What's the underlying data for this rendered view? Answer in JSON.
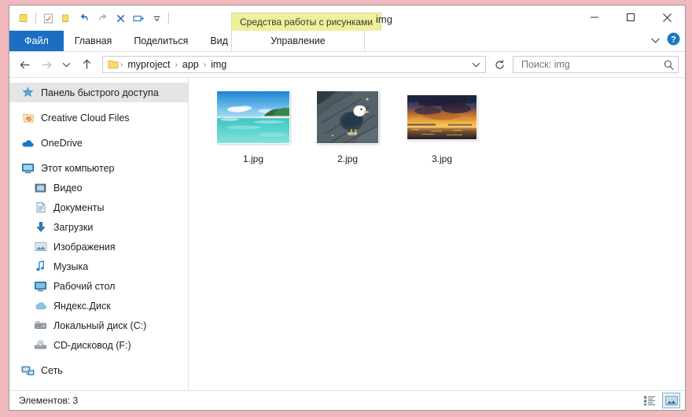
{
  "window": {
    "title": "img",
    "contextual_tab_title": "Средства работы с рисунками",
    "contextual_tab_sub": "Управление",
    "minimize_label": "Свернуть",
    "maximize_label": "Развернуть",
    "close_label": "Закрыть",
    "accent_color": "#1b6ec2",
    "contextual_tab_color": "#efef9c",
    "frame_background": "#f0b8bd"
  },
  "quick_access": {
    "items": [
      {
        "icon": "folder-icon",
        "label": "Проводник"
      },
      {
        "icon": "separator",
        "label": ""
      },
      {
        "icon": "properties-icon",
        "label": "Свойства"
      },
      {
        "icon": "new-folder-icon",
        "label": "Создать папку"
      },
      {
        "icon": "undo-icon",
        "label": "Отменить"
      },
      {
        "icon": "redo-icon",
        "label": "Вернуть"
      },
      {
        "icon": "delete-icon",
        "label": "Удалить"
      },
      {
        "icon": "rename-icon",
        "label": "Переименовать"
      },
      {
        "icon": "chevron-down-icon",
        "label": "Настройка панели быстрого доступа"
      }
    ]
  },
  "ribbon": {
    "tabs": [
      {
        "label": "Файл",
        "selected": true
      },
      {
        "label": "Главная",
        "selected": false
      },
      {
        "label": "Поделиться",
        "selected": false
      },
      {
        "label": "Вид",
        "selected": false
      }
    ],
    "expand_icon": "chevron-down-icon",
    "help_icon": "help-icon"
  },
  "address": {
    "back_label": "Назад",
    "forward_label": "Вперед",
    "recent_label": "Последние расположения",
    "up_label": "Вверх",
    "refresh_label": "Обновить",
    "breadcrumbs": [
      "myproject",
      "app",
      "img"
    ],
    "separator": "›",
    "dropdown_icon": "chevron-down-icon"
  },
  "search": {
    "value": "",
    "placeholder": "Поиск: img",
    "icon": "search-icon"
  },
  "sidebar": {
    "items": [
      {
        "label": "Панель быстрого доступа",
        "icon": "star-icon",
        "indent": 0,
        "selected": true,
        "gap_before": false
      },
      {
        "label": "Creative Cloud Files",
        "icon": "creative-cloud-icon",
        "indent": 0,
        "selected": false,
        "gap_before": true
      },
      {
        "label": "OneDrive",
        "icon": "onedrive-icon",
        "indent": 0,
        "selected": false,
        "gap_before": true
      },
      {
        "label": "Этот компьютер",
        "icon": "this-pc-icon",
        "indent": 0,
        "selected": false,
        "gap_before": true
      },
      {
        "label": "Видео",
        "icon": "videos-icon",
        "indent": 1,
        "selected": false,
        "gap_before": false
      },
      {
        "label": "Документы",
        "icon": "documents-icon",
        "indent": 1,
        "selected": false,
        "gap_before": false
      },
      {
        "label": "Загрузки",
        "icon": "downloads-icon",
        "indent": 1,
        "selected": false,
        "gap_before": false
      },
      {
        "label": "Изображения",
        "icon": "pictures-icon",
        "indent": 1,
        "selected": false,
        "gap_before": false
      },
      {
        "label": "Музыка",
        "icon": "music-icon",
        "indent": 1,
        "selected": false,
        "gap_before": false
      },
      {
        "label": "Рабочий стол",
        "icon": "desktop-icon",
        "indent": 1,
        "selected": false,
        "gap_before": false
      },
      {
        "label": "Яндекс.Диск",
        "icon": "yandex-disk-icon",
        "indent": 1,
        "selected": false,
        "gap_before": false
      },
      {
        "label": "Локальный диск (C:)",
        "icon": "hard-drive-icon",
        "indent": 1,
        "selected": false,
        "gap_before": false
      },
      {
        "label": "CD-дисковод (F:)",
        "icon": "cd-drive-icon",
        "indent": 1,
        "selected": false,
        "gap_before": false
      },
      {
        "label": "Сеть",
        "icon": "network-icon",
        "indent": 0,
        "selected": false,
        "gap_before": true
      }
    ]
  },
  "files": [
    {
      "name": "1.jpg",
      "thumbnail": "tropical-beach-photo"
    },
    {
      "name": "2.jpg",
      "thumbnail": "seagull-on-dock-photo"
    },
    {
      "name": "3.jpg",
      "thumbnail": "sunset-over-water-photo"
    }
  ],
  "status": {
    "item_count_text": "Элементов: 3",
    "views": [
      {
        "name": "details-view",
        "label": "Таблица",
        "active": false
      },
      {
        "name": "large-icons-view",
        "label": "Крупные значки",
        "active": true
      }
    ]
  }
}
